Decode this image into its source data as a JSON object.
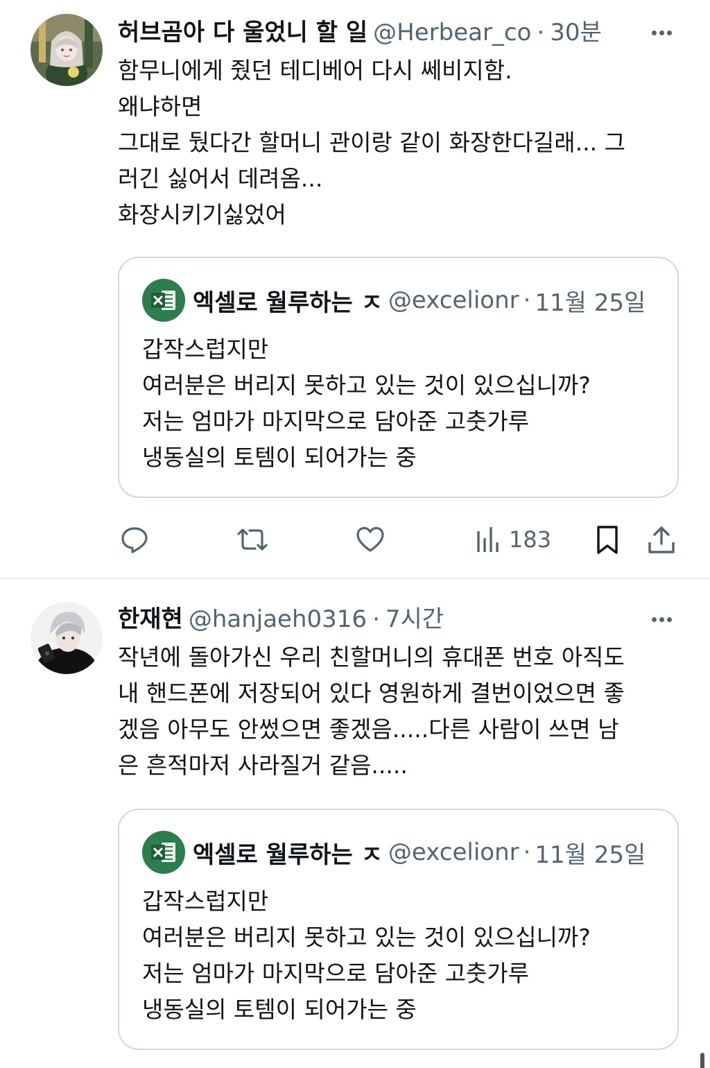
{
  "tweets": [
    {
      "display_name": "허브곰아 다 울었니 할 일",
      "handle": "@Herbear_co",
      "separator": "·",
      "time": "30분",
      "lines": [
        "함무니에게 줬던 테디베어 다시 쎄비지함.",
        "왜냐하면",
        "그대로 뒀다간 할머니 관이랑 같이 화장한다길래... 그",
        "러긴 싫어서 데려옴...",
        "화장시키기싫었어"
      ],
      "quote": {
        "display_name": "엑셀로 월루하는 ㅈ",
        "handle": "@excelionr",
        "separator": "·",
        "date": "11월 25일",
        "lines": [
          "갑작스럽지만",
          "여러분은 버리지 못하고 있는 것이 있으십니까?",
          "저는 엄마가 마지막으로 담아준 고춧가루",
          "냉동실의 토템이 되어가는 중"
        ]
      },
      "actions": {
        "views": "183",
        "icons": [
          "reply-icon",
          "retweet-icon",
          "like-icon",
          "views-icon",
          "bookmark-icon",
          "share-icon"
        ]
      }
    },
    {
      "display_name": "한재현",
      "handle": "@hanjaeh0316",
      "separator": "·",
      "time": "7시간",
      "lines": [
        "작년에 돌아가신 우리 친할머니의 휴대폰 번호 아직도",
        "내 핸드폰에 저장되어 있다 영원하게 결번이었으면 좋",
        "겠음 아무도 안썼으면 좋겠음.....다른 사람이 쓰면 남",
        "은 흔적마저 사라질거 같음....."
      ],
      "quote": {
        "display_name": "엑셀로 월루하는 ㅈ",
        "handle": "@excelionr",
        "separator": "·",
        "date": "11월 25일",
        "lines": [
          "갑작스럽지만",
          "여러분은 버리지 못하고 있는 것이 있으십니까?",
          "저는 엄마가 마지막으로 담아준 고춧가루",
          "냉동실의 토템이 되어가는 중"
        ]
      }
    }
  ],
  "colors": {
    "text_primary": "#0f1419",
    "text_secondary": "#536471",
    "border": "#cfd9de",
    "excel_green": "#2e7d4f"
  }
}
